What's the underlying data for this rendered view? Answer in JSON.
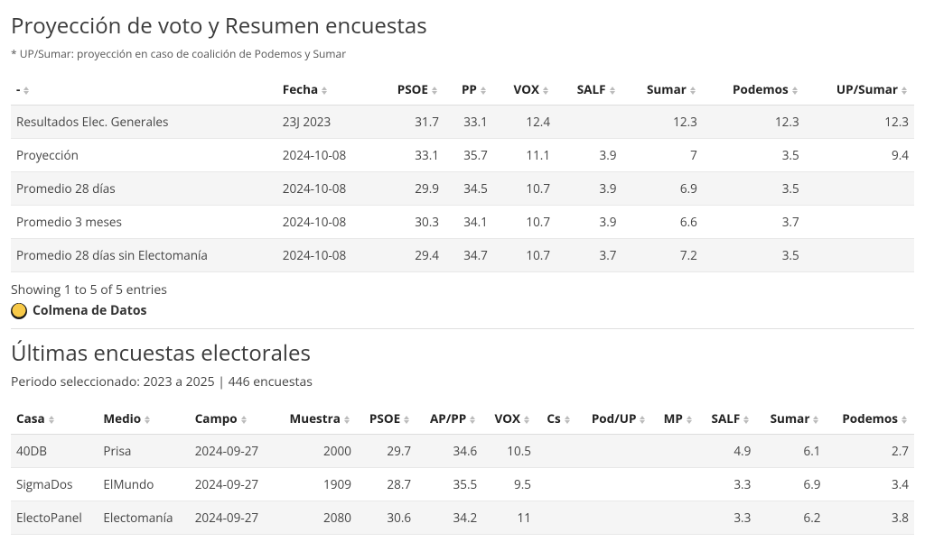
{
  "section1": {
    "title": "Proyección de voto y Resumen encuestas",
    "note": "* UP/Sumar: proyección en caso de coalición de Podemos y Sumar",
    "headers": [
      "-",
      "Fecha",
      "PSOE",
      "PP",
      "VOX",
      "SALF",
      "Sumar",
      "Podemos",
      "UP/Sumar"
    ],
    "numericFrom": 2,
    "rows": [
      [
        "Resultados Elec. Generales",
        "23J 2023",
        "31.7",
        "33.1",
        "12.4",
        "",
        "12.3",
        "12.3",
        "12.3"
      ],
      [
        "Proyección",
        "2024-10-08",
        "33.1",
        "35.7",
        "11.1",
        "3.9",
        "7",
        "3.5",
        "9.4"
      ],
      [
        "Promedio 28 días",
        "2024-10-08",
        "29.9",
        "34.5",
        "10.7",
        "3.9",
        "6.9",
        "3.5",
        ""
      ],
      [
        "Promedio 3 meses",
        "2024-10-08",
        "30.3",
        "34.1",
        "10.7",
        "3.9",
        "6.6",
        "3.7",
        ""
      ],
      [
        "Promedio 28 días sin Electomanía",
        "2024-10-08",
        "29.4",
        "34.7",
        "10.7",
        "3.7",
        "7.2",
        "3.5",
        ""
      ]
    ],
    "showing": "Showing 1 to 5 of 5 entries",
    "attribution": "Colmena de Datos"
  },
  "section2": {
    "title": "Últimas encuestas electorales",
    "period": "Periodo seleccionado: 2023 a 2025 | 446 encuestas",
    "headers": [
      "Casa",
      "Medio",
      "Campo",
      "Muestra",
      "PSOE",
      "AP/PP",
      "VOX",
      "Cs",
      "Pod/UP",
      "MP",
      "SALF",
      "Sumar",
      "Podemos"
    ],
    "numericFrom": 3,
    "rows": [
      [
        "40DB",
        "Prisa",
        "2024-09-27",
        "2000",
        "29.7",
        "34.6",
        "10.5",
        "",
        "",
        "",
        "4.9",
        "6.1",
        "2.7"
      ],
      [
        "SigmaDos",
        "ElMundo",
        "2024-09-27",
        "1909",
        "28.7",
        "35.5",
        "9.5",
        "",
        "",
        "",
        "3.3",
        "6.9",
        "3.4"
      ],
      [
        "ElectoPanel",
        "Electomanía",
        "2024-09-27",
        "2080",
        "30.6",
        "34.2",
        "11",
        "",
        "",
        "",
        "3.3",
        "6.2",
        "3.8"
      ]
    ]
  }
}
